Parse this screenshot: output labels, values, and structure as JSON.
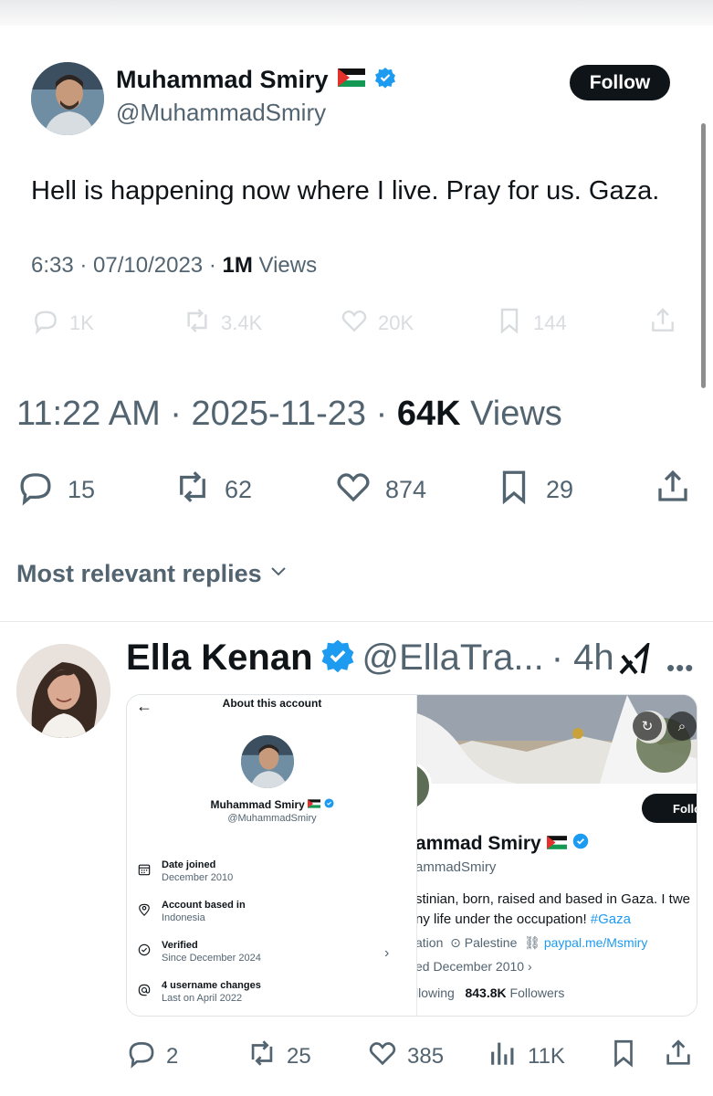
{
  "quoted": {
    "name": "Muhammad Smiry",
    "handle": "@MuhammadSmiry",
    "follow_label": "Follow",
    "text": "Hell is happening now where I live. Pray for us. Gaza.",
    "time": "6:33 · 07/10/2023 · ",
    "views_count": "1M",
    "views_label": " Views",
    "stats": {
      "replies": "1K",
      "reposts": "3.4K",
      "likes": "20K",
      "bookmarks": "144"
    }
  },
  "main": {
    "timestamp": "11:22 AM · 2025-11-23 · ",
    "views_count": "64K",
    "views_label": " Views",
    "stats": {
      "replies": "15",
      "reposts": "62",
      "likes": "874",
      "bookmarks": "29"
    }
  },
  "replies_sort_label": "Most relevant replies",
  "reply": {
    "name": "Ella Kenan",
    "handle": "@EllaTra...",
    "time": "· 4h",
    "stats": {
      "replies": "2",
      "reposts": "25",
      "likes": "385",
      "views": "11K"
    },
    "embed": {
      "about_title": "About this account",
      "name": "Muhammad Smiry",
      "handle": "@MuhammadSmiry",
      "rows": [
        {
          "label": "Date joined",
          "value": "December 2010",
          "icon": "calendar-icon"
        },
        {
          "label": "Account based in",
          "value": "Indonesia",
          "icon": "location-icon"
        },
        {
          "label": "Verified",
          "value": "Since December 2024",
          "icon": "verified-check-icon"
        },
        {
          "label": "4 username changes",
          "value": "Last on April 2022",
          "icon": "at-icon"
        }
      ],
      "profile": {
        "follow_label": "Follo",
        "name": "ammad Smiry",
        "handle": "ammadSmiry",
        "bio_line1": "stinian, born, raised and based in Gaza. I twe",
        "bio_line2": "ny life under the occupation! ",
        "bio_tag": "#Gaza",
        "info_prefix": "ation",
        "location": "Palestine",
        "link": "paypal.me/Msmiry",
        "joined": "ed December 2010",
        "following_label": "llowing",
        "followers_count": "843.8K",
        "followers_label": "Followers"
      }
    }
  },
  "colors": {
    "verified_blue": "#1d9bf0",
    "text_gray": "#536471",
    "text_dark": "#0f1419"
  }
}
